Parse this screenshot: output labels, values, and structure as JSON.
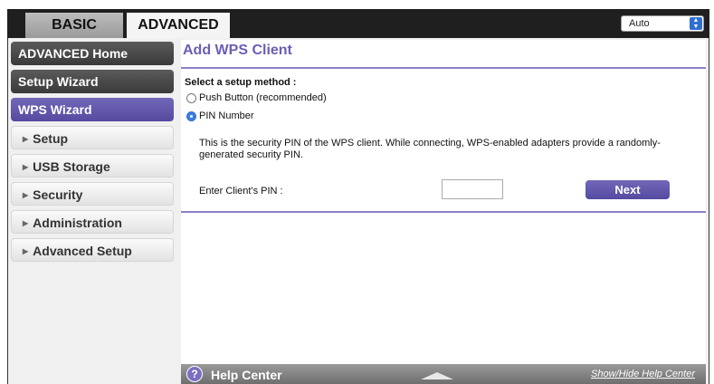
{
  "tabs": {
    "basic": "BASIC",
    "advanced": "ADVANCED"
  },
  "language_select": {
    "value": "Auto"
  },
  "sidebar": {
    "items": [
      {
        "label": "ADVANCED Home"
      },
      {
        "label": "Setup Wizard"
      },
      {
        "label": "WPS Wizard"
      },
      {
        "label": "Setup"
      },
      {
        "label": "USB Storage"
      },
      {
        "label": "Security"
      },
      {
        "label": "Administration"
      },
      {
        "label": "Advanced Setup"
      }
    ]
  },
  "main": {
    "title": "Add WPS Client",
    "method_label": "Select a setup method :",
    "options": [
      {
        "label": "Push Button (recommended)",
        "selected": false
      },
      {
        "label": "PIN Number",
        "selected": true
      }
    ],
    "description": "This is the security PIN of the WPS client. While connecting, WPS-enabled adapters provide a randomly-generated security PIN.",
    "pin_label": "Enter Client's PIN :",
    "pin_value": "",
    "next_label": "Next"
  },
  "help": {
    "label": "Help Center",
    "toggle": "Show/Hide Help Center",
    "icon_glyph": "?"
  },
  "colors": {
    "accent": "#6a5fb6",
    "active_nav": "#5d52a8",
    "dark_nav": "#444444"
  }
}
